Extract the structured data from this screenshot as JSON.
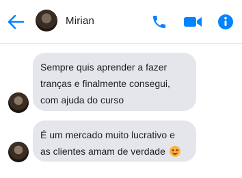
{
  "header": {
    "contact_name": "Mirian",
    "icons": {
      "back": "back-arrow-icon",
      "phone": "phone-icon",
      "video": "video-camera-icon",
      "info": "info-icon"
    },
    "accent_color": "#0084ff"
  },
  "messages": [
    {
      "lines": [
        "Sempre quis aprender a fazer",
        "tranças  e finalmente consegui,",
        "com ajuda do curso"
      ]
    },
    {
      "lines": [
        "É um mercado muito lucrativo e",
        "as clientes amam de verdade"
      ],
      "emoji": "smiling-face-with-hearts"
    }
  ],
  "colors": {
    "bubble_bg": "#e4e6eb",
    "text": "#1c1e21"
  }
}
